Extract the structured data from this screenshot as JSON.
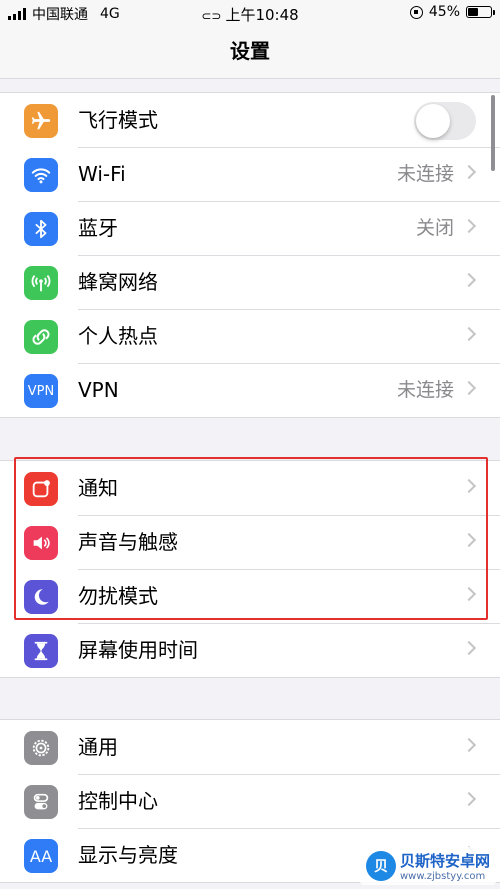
{
  "status_bar": {
    "carrier": "中国联通",
    "network": "4G",
    "time": "上午10:48",
    "battery": "45%",
    "battery_level": 0.45
  },
  "nav": {
    "title": "设置"
  },
  "colors": {
    "airplane": "#f09a37",
    "wifi": "#2f7cf6",
    "bluetooth": "#2f7cf6",
    "cellular": "#3fc658",
    "hotspot": "#3fc658",
    "vpn": "#2f7cf6",
    "notifications": "#ee3b32",
    "sounds": "#ee3a5b",
    "dnd": "#5b54d6",
    "screen_time": "#5b54d6",
    "general": "#8e8e93",
    "control_center": "#8e8e93",
    "display": "#2f7cf6",
    "highlight": "#e3302f"
  },
  "section1": {
    "airplane": {
      "label": "飞行模式",
      "icon": "airplane-icon",
      "toggle_on": false
    },
    "wifi": {
      "label": "Wi-Fi",
      "value": "未连接",
      "icon": "wifi-icon"
    },
    "bluetooth": {
      "label": "蓝牙",
      "value": "关闭",
      "icon": "bluetooth-icon"
    },
    "cellular": {
      "label": "蜂窝网络",
      "icon": "cellular-antenna-icon"
    },
    "hotspot": {
      "label": "个人热点",
      "icon": "hotspot-link-icon"
    },
    "vpn": {
      "label": "VPN",
      "value": "未连接",
      "icon_text": "VPN"
    }
  },
  "section2": {
    "notifications": {
      "label": "通知",
      "icon": "notifications-icon"
    },
    "sounds": {
      "label": "声音与触感",
      "icon": "speaker-icon"
    },
    "dnd": {
      "label": "勿扰模式",
      "icon": "moon-icon"
    },
    "screen_time": {
      "label": "屏幕使用时间",
      "icon": "hourglass-icon"
    }
  },
  "section3": {
    "general": {
      "label": "通用",
      "icon": "gear-icon"
    },
    "control_center": {
      "label": "控制中心",
      "icon": "switches-icon"
    },
    "display": {
      "label": "显示与亮度",
      "icon_text": "AA"
    }
  },
  "watermark": {
    "name": "贝斯特安卓网",
    "url": "www.zjbstyy.com",
    "logo_letter": "贝"
  }
}
